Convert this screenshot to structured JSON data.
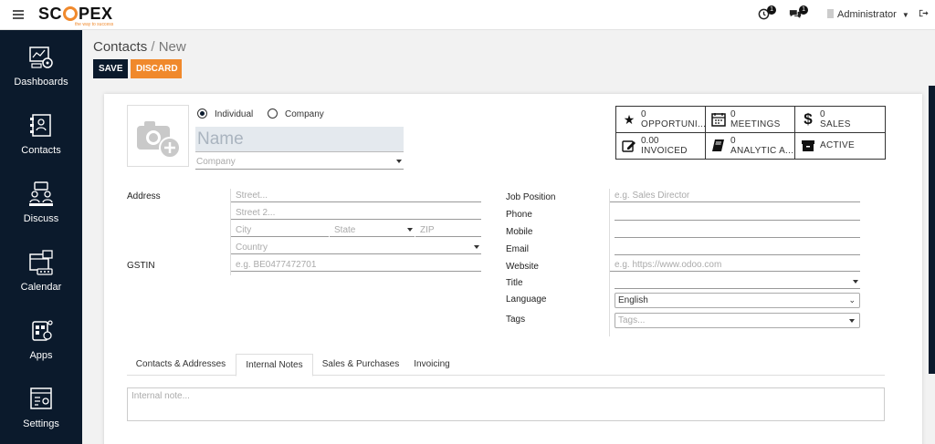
{
  "brand": {
    "logo_left": "SC",
    "logo_right": "PEX",
    "tagline": "the way to success"
  },
  "topbar": {
    "activity_count": "1",
    "messages_count": "1",
    "user_name": "Administrator"
  },
  "sidebar": {
    "items": [
      {
        "label": "Dashboards",
        "icon": "dashboard-icon"
      },
      {
        "label": "Contacts",
        "icon": "contacts-icon"
      },
      {
        "label": "Discuss",
        "icon": "discuss-icon"
      },
      {
        "label": "Calendar",
        "icon": "calendar-icon"
      },
      {
        "label": "Apps",
        "icon": "apps-icon"
      },
      {
        "label": "Settings",
        "icon": "settings-icon"
      }
    ]
  },
  "breadcrumb": {
    "parent": "Contacts",
    "separator": "/",
    "current": "New"
  },
  "actions": {
    "save": "SAVE",
    "discard": "DISCARD"
  },
  "form": {
    "type_options": {
      "individual": "Individual",
      "company": "Company",
      "selected": "Individual"
    },
    "name_placeholder": "Name",
    "company_placeholder": "Company",
    "smart_buttons": [
      {
        "value": "0",
        "label": "OPPORTUNI...",
        "icon": "star-icon"
      },
      {
        "value": "0",
        "label": "MEETINGS",
        "icon": "calendar-icon"
      },
      {
        "value": "0",
        "label": "SALES",
        "icon": "dollar-icon"
      },
      {
        "value": "0.00",
        "label": "INVOICED",
        "icon": "edit-icon"
      },
      {
        "value": "0",
        "label": "ANALYTIC A...",
        "icon": "book-icon"
      },
      {
        "value": "",
        "label": "ACTIVE",
        "icon": "archive-icon"
      }
    ],
    "address": {
      "label": "Address",
      "street_placeholder": "Street...",
      "street2_placeholder": "Street 2...",
      "city_placeholder": "City",
      "state_placeholder": "State",
      "zip_placeholder": "ZIP",
      "country_placeholder": "Country"
    },
    "gstin": {
      "label": "GSTIN",
      "placeholder": "e.g. BE0477472701"
    },
    "job_position": {
      "label": "Job Position",
      "placeholder": "e.g. Sales Director"
    },
    "phone": {
      "label": "Phone"
    },
    "mobile": {
      "label": "Mobile"
    },
    "email": {
      "label": "Email"
    },
    "website": {
      "label": "Website",
      "placeholder": "e.g. https://www.odoo.com"
    },
    "title": {
      "label": "Title"
    },
    "language": {
      "label": "Language",
      "value": "English"
    },
    "tags": {
      "label": "Tags",
      "placeholder": "Tags..."
    }
  },
  "tabs": [
    {
      "label": "Contacts & Addresses"
    },
    {
      "label": "Internal Notes",
      "active": true
    },
    {
      "label": "Sales & Purchases"
    },
    {
      "label": "Invoicing"
    }
  ],
  "internal_note_placeholder": "Internal note..."
}
